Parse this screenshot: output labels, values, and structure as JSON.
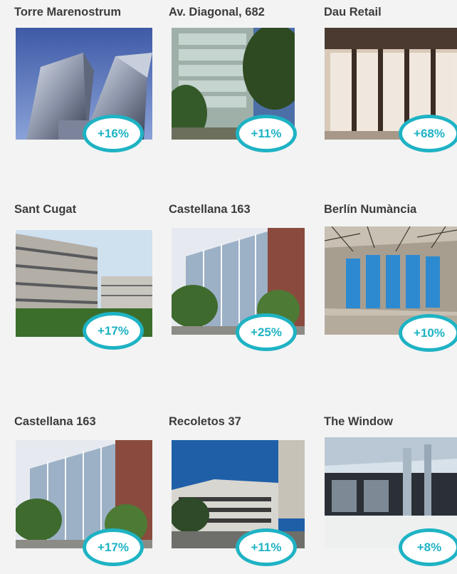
{
  "accent_color": "#1eb3c4",
  "properties": [
    {
      "name": "Torre Marenostrum",
      "change": "+16%",
      "image": "glass-tower-image"
    },
    {
      "name": "Av. Diagonal, 682",
      "change": "+11%",
      "image": "glass-office-trees-image"
    },
    {
      "name": "Dau Retail",
      "change": "+68%",
      "image": "retail-storefront-image"
    },
    {
      "name": "Sant Cugat",
      "change": "+17%",
      "image": "office-campus-image"
    },
    {
      "name": "Castellana 163",
      "change": "+25%",
      "image": "office-facade-avenue-image"
    },
    {
      "name": "Berlín Numància",
      "change": "+10%",
      "image": "glass-facade-tree-image"
    },
    {
      "name": "Castellana 163",
      "change": "+17%",
      "image": "office-facade-avenue-image"
    },
    {
      "name": "Recoletos 37",
      "change": "+11%",
      "image": "white-building-street-image"
    },
    {
      "name": "The Window",
      "change": "+8%",
      "image": "glass-lobby-image"
    }
  ]
}
